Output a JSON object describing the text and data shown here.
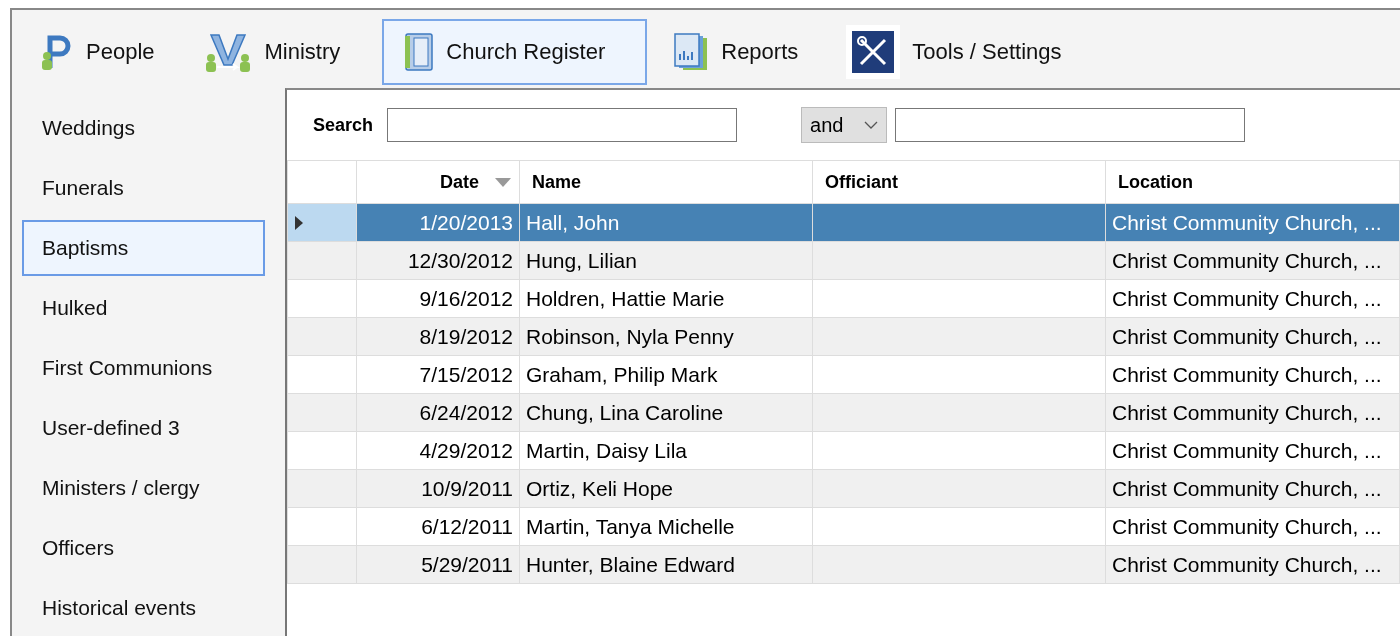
{
  "toolbar": {
    "tabs": [
      {
        "label": "People",
        "kind": "people",
        "selected": false
      },
      {
        "label": "Ministry",
        "kind": "ministry",
        "selected": false
      },
      {
        "label": "Church Register",
        "kind": "register",
        "selected": true
      },
      {
        "label": "Reports",
        "kind": "reports",
        "selected": false
      },
      {
        "label": "Tools / Settings",
        "kind": "tools",
        "selected": false
      }
    ]
  },
  "sidebar": {
    "items": [
      {
        "label": "Weddings",
        "selected": false
      },
      {
        "label": "Funerals",
        "selected": false
      },
      {
        "label": "Baptisms",
        "selected": true
      },
      {
        "label": "Hulked",
        "selected": false
      },
      {
        "label": "First Communions",
        "selected": false
      },
      {
        "label": "User-defined 3",
        "selected": false
      },
      {
        "label": "Ministers / clergy",
        "selected": false
      },
      {
        "label": "Officers",
        "selected": false
      },
      {
        "label": "Historical events",
        "selected": false
      }
    ]
  },
  "search": {
    "label": "Search",
    "operator": "and"
  },
  "table": {
    "columns": [
      {
        "label": "Date",
        "sorted": true
      },
      {
        "label": "Name",
        "sorted": false
      },
      {
        "label": "Officiant",
        "sorted": false
      },
      {
        "label": "Location",
        "sorted": false
      }
    ],
    "rows": [
      {
        "date": "1/20/2013",
        "name": "Hall, John",
        "location": "Christ Community Church, ...",
        "selected": true
      },
      {
        "date": "12/30/2012",
        "name": "Hung, Lilian",
        "location": "Christ Community Church, ...",
        "selected": false
      },
      {
        "date": "9/16/2012",
        "name": "Holdren, Hattie Marie",
        "location": "Christ Community Church, ...",
        "selected": false
      },
      {
        "date": "8/19/2012",
        "name": "Robinson, Nyla Penny",
        "location": "Christ Community Church, ...",
        "selected": false
      },
      {
        "date": "7/15/2012",
        "name": "Graham, Philip Mark",
        "location": "Christ Community Church, ...",
        "selected": false
      },
      {
        "date": "6/24/2012",
        "name": "Chung, Lina Caroline",
        "location": "Christ Community Church, ...",
        "selected": false
      },
      {
        "date": "4/29/2012",
        "name": "Martin, Daisy Lila",
        "location": "Christ Community Church, ...",
        "selected": false
      },
      {
        "date": "10/9/2011",
        "name": "Ortiz, Keli Hope",
        "location": "Christ Community Church, ...",
        "selected": false
      },
      {
        "date": "6/12/2011",
        "name": "Martin, Tanya Michelle",
        "location": "Christ Community Church, ...",
        "selected": false
      },
      {
        "date": "5/29/2011",
        "name": "Hunter, Blaine Edward",
        "location": "Christ Community Church, ...",
        "selected": false
      }
    ]
  }
}
